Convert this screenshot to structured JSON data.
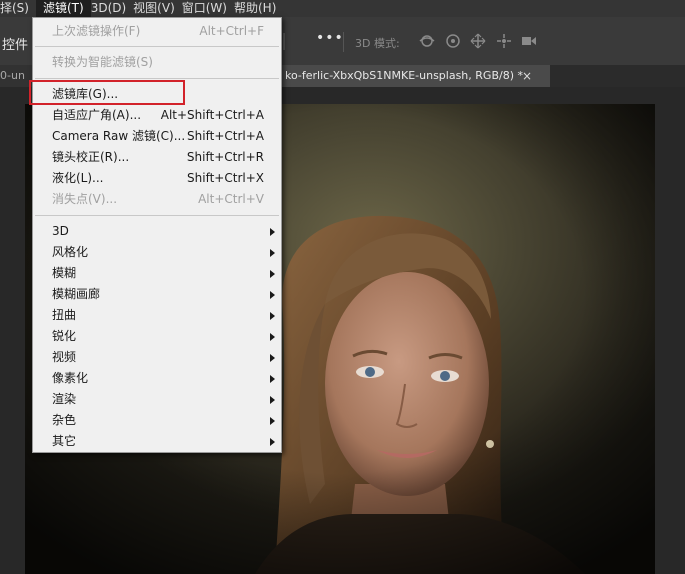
{
  "menubar": {
    "items": [
      {
        "label": "择(S)"
      },
      {
        "label": "滤镜(T)"
      },
      {
        "label": "3D(D)"
      },
      {
        "label": "视图(V)"
      },
      {
        "label": "窗口(W)"
      },
      {
        "label": "帮助(H)"
      }
    ],
    "active_index": 1
  },
  "options": {
    "left_label": "控件",
    "more": "•••",
    "mode_label": "3D 模式:",
    "icons": [
      "orbit-icon",
      "roll-icon",
      "pan-icon",
      "slide-icon",
      "camera-zoom-icon"
    ]
  },
  "tabs": {
    "left_tab": "0-un",
    "active_tab": "ko-ferlic-XbxQbS1NMKE-unsplash, RGB/8) *",
    "close": "×"
  },
  "filter_menu": {
    "last_filter": {
      "label": "上次滤镜操作(F)",
      "shortcut": "Alt+Ctrl+F",
      "disabled": true
    },
    "smart_filter": {
      "label": "转换为智能滤镜(S)",
      "disabled": true
    },
    "group1": [
      {
        "label": "滤镜库(G)...",
        "shortcut": ""
      },
      {
        "label": "自适应广角(A)...",
        "shortcut": "Alt+Shift+Ctrl+A"
      },
      {
        "label": "Camera Raw 滤镜(C)...",
        "shortcut": "Shift+Ctrl+A"
      },
      {
        "label": "镜头校正(R)...",
        "shortcut": "Shift+Ctrl+R"
      },
      {
        "label": "液化(L)...",
        "shortcut": "Shift+Ctrl+X"
      },
      {
        "label": "消失点(V)...",
        "shortcut": "Alt+Ctrl+V",
        "disabled": true
      }
    ],
    "submenus": [
      "3D",
      "风格化",
      "模糊",
      "模糊画廊",
      "扭曲",
      "锐化",
      "视频",
      "像素化",
      "渲染",
      "杂色",
      "其它"
    ]
  },
  "colors": {
    "highlight_border": "#d2222a",
    "menu_bg": "#f0f0f0",
    "app_bg": "#282828"
  }
}
